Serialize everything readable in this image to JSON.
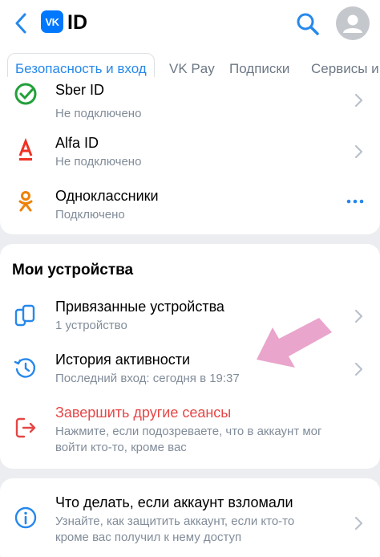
{
  "header": {
    "logo_mark": "VK",
    "logo_text": "ID"
  },
  "tabs": [
    {
      "label": "Безопасность и вход",
      "active": true
    },
    {
      "label": "VK Pay"
    },
    {
      "label": "Подписки"
    },
    {
      "label": "Сервисы и"
    }
  ],
  "services": [
    {
      "title": "Sber ID",
      "status": "Не подключено",
      "icon": "sber-icon"
    },
    {
      "title": "Alfa ID",
      "status": "Не подключено",
      "icon": "alfa-icon"
    },
    {
      "title": "Одноклассники",
      "status": "Подключено",
      "icon": "ok-icon"
    }
  ],
  "devices": {
    "section_title": "Мои устройства",
    "items": [
      {
        "title": "Привязанные устройства",
        "sub": "1 устройство",
        "icon": "devices-icon"
      },
      {
        "title": "История активности",
        "sub": "Последний вход: сегодня в 19:37",
        "icon": "history-icon"
      },
      {
        "title": "Завершить другие сеансы",
        "sub1": "Нажмите, если подозреваете, что в аккаунт мог",
        "sub2": "войти кто-то, кроме вас",
        "icon": "logout-icon"
      }
    ]
  },
  "help": {
    "title": "Что делать, если аккаунт взломали",
    "sub1": "Узнайте, как защитить аккаунт, если кто-то",
    "sub2": "кроме вас получил к нему доступ",
    "icon": "info-icon"
  },
  "colors": {
    "accent": "#2688eb",
    "danger": "#e64646",
    "background": "#ebedf0",
    "annotation_arrow": "#e8a0c8"
  }
}
